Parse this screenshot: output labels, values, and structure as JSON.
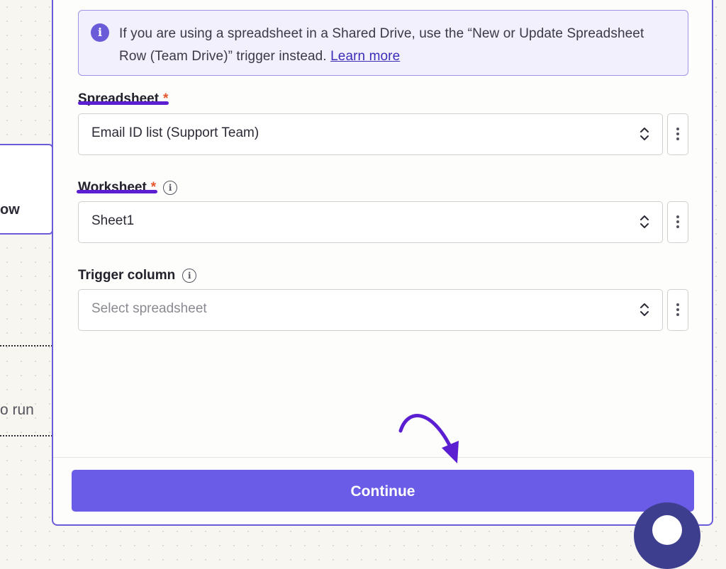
{
  "background": {
    "card_text_fragment": "ow",
    "run_text_fragment": "o run"
  },
  "info_banner": {
    "icon": "info-icon",
    "text": "If you are using a spreadsheet in a Shared Drive, use the “New or Update Spreadsheet Row (Team Drive)” trigger instead.",
    "link_label": "Learn more"
  },
  "fields": {
    "spreadsheet": {
      "label": "Spreadsheet",
      "required_mark": "*",
      "value": "Email ID list (Support Team)"
    },
    "worksheet": {
      "label": "Worksheet",
      "required_mark": "*",
      "value": "Sheet1"
    },
    "trigger_column": {
      "label": "Trigger column",
      "placeholder": "Select spreadsheet"
    }
  },
  "continue_button": {
    "label": "Continue"
  },
  "colors": {
    "accent": "#6a5ce6",
    "annotation": "#5b1fd1",
    "required": "#e4572e"
  }
}
